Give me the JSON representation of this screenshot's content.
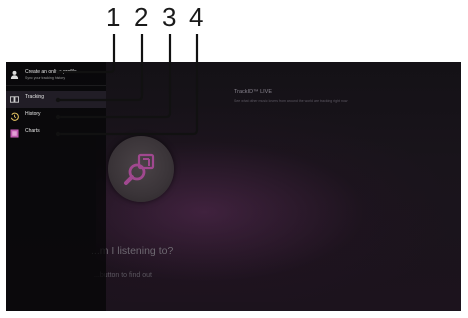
{
  "callouts": [
    "1",
    "2",
    "3",
    "4"
  ],
  "menu": {
    "profile": {
      "label": "Create an online profile",
      "sublabel": "Sync your tracking history",
      "icon": "person-icon"
    },
    "items": [
      {
        "label": "Tracking",
        "icon": "tracking-icon"
      },
      {
        "label": "History",
        "icon": "history-icon"
      },
      {
        "label": "Charts",
        "icon": "charts-icon"
      }
    ]
  },
  "main": {
    "app_title": "TrackID™ LIVE",
    "app_desc": "See what other music lovers from around the world are tracking right now",
    "prompt_title_partial": "...m I listening to?",
    "prompt_sub_partial": "...button to find out"
  },
  "colors": {
    "accent": "#a0488f",
    "screen_bg": "#171318"
  }
}
